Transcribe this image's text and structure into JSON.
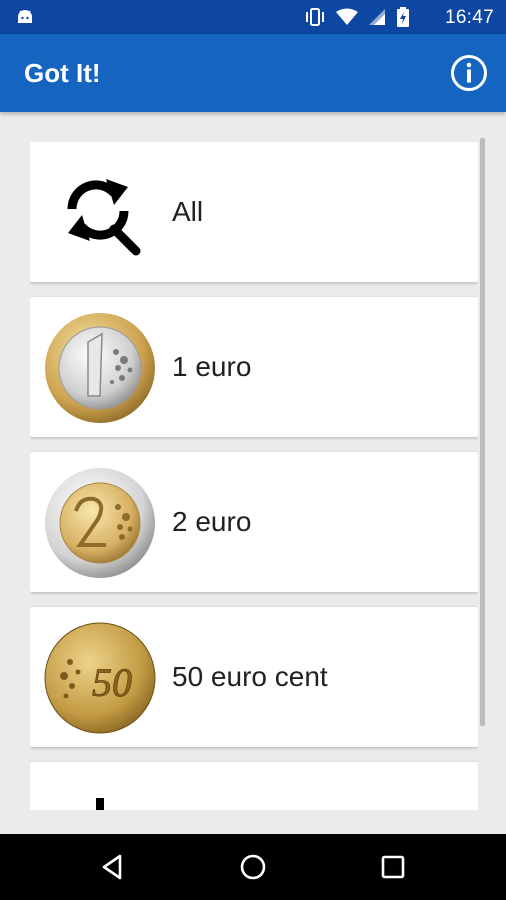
{
  "status_bar": {
    "time": "16:47",
    "icons": [
      "android-icon",
      "vibrate-icon",
      "wifi-icon",
      "signal-icon",
      "battery-icon"
    ]
  },
  "app_bar": {
    "title": "Got It!",
    "info_icon": "info-icon"
  },
  "items": [
    {
      "label": "All",
      "icon": "refresh-search-icon"
    },
    {
      "label": "1 euro",
      "icon": "one-euro-coin"
    },
    {
      "label": "2 euro",
      "icon": "two-euro-coin"
    },
    {
      "label": "50 euro cent",
      "icon": "fifty-cent-coin"
    }
  ],
  "nav_bar": [
    "back-icon",
    "home-icon",
    "recents-icon"
  ],
  "colors": {
    "status_bar": "#0d47a1",
    "app_bar": "#1565c0",
    "background": "#ebebeb",
    "card": "#ffffff"
  }
}
